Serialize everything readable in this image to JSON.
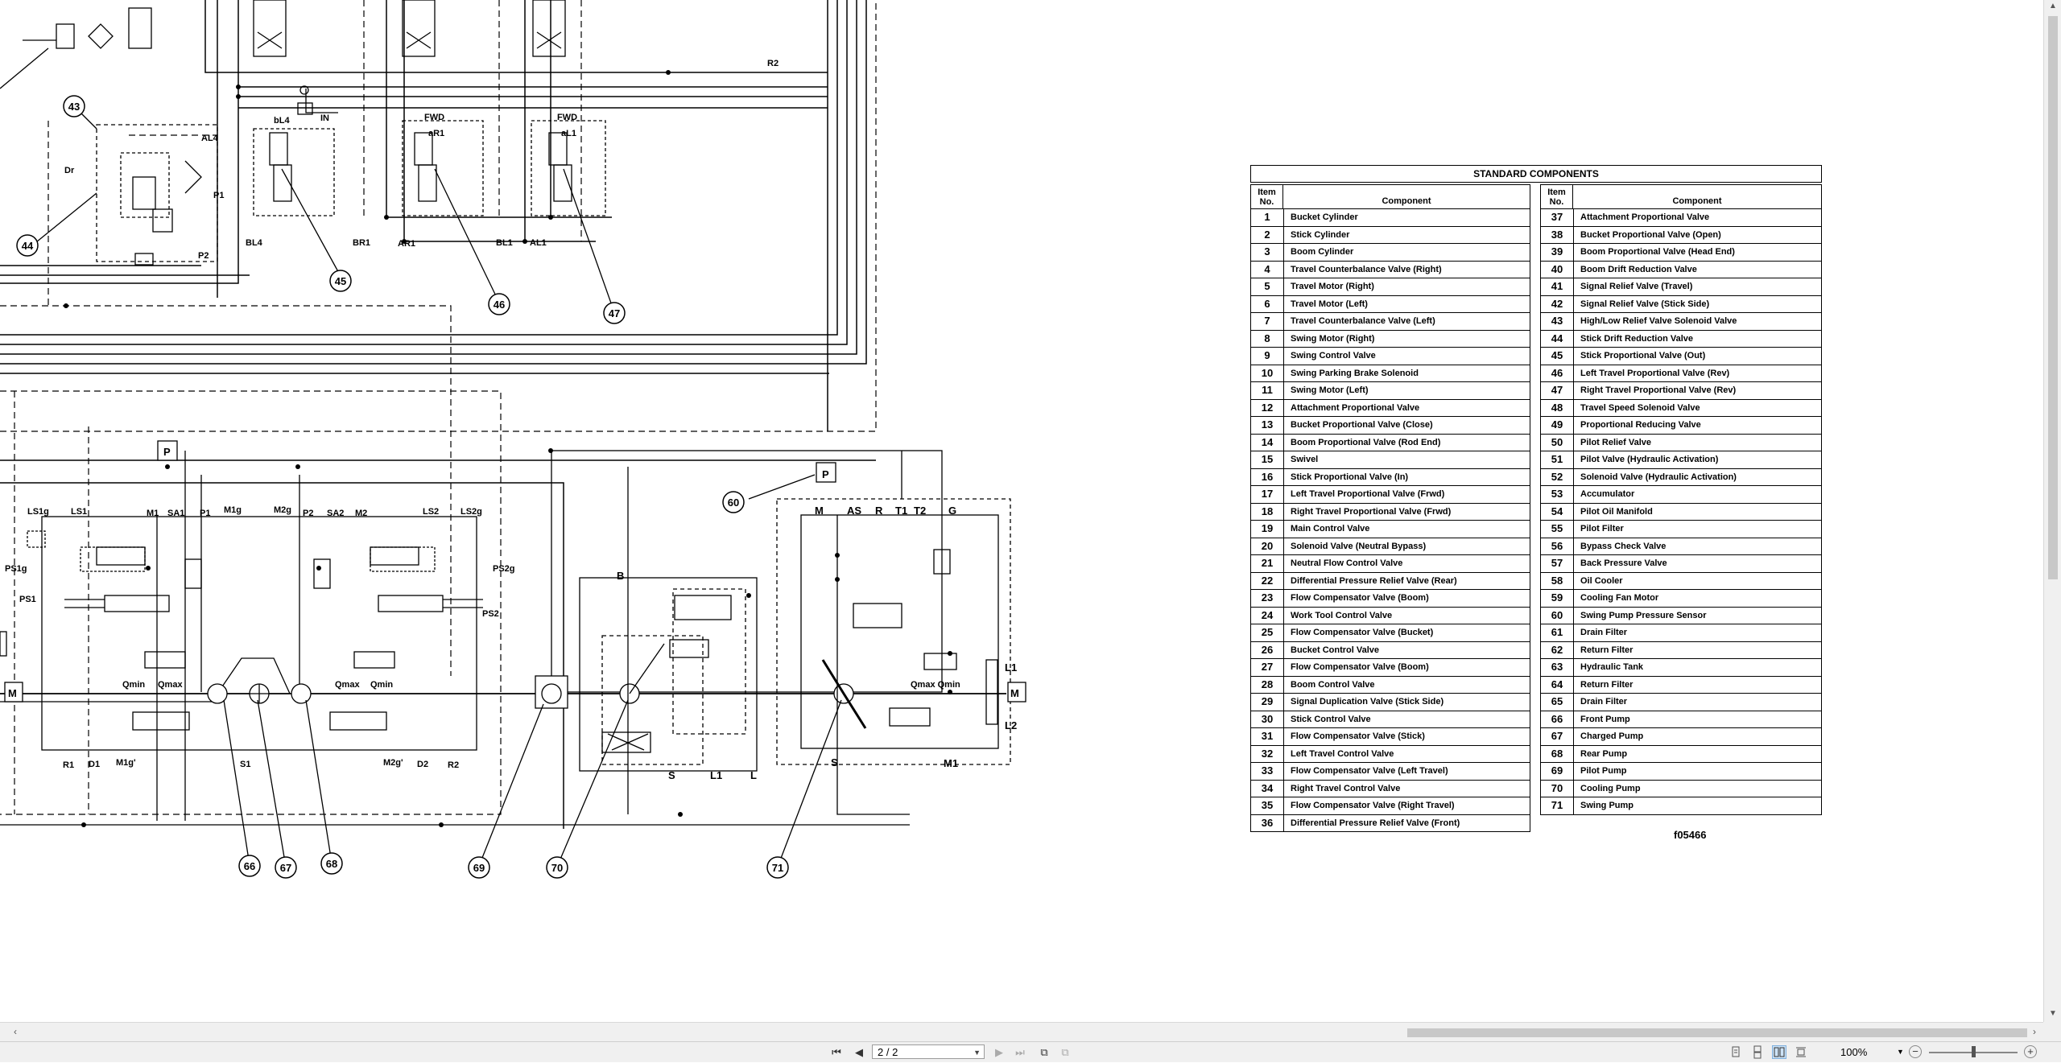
{
  "diagram": {
    "callouts": [
      "43",
      "44",
      "45",
      "46",
      "47",
      "60",
      "66",
      "67",
      "68",
      "69",
      "70",
      "71"
    ],
    "labels": {
      "AL4": "AL4",
      "Dr": "Dr",
      "P1": "P1",
      "P2": "P2",
      "bL4": "bL4",
      "IN": "IN",
      "BL4": "BL4",
      "BR1": "BR1",
      "AR1": "AR1",
      "BL1": "BL1",
      "AL1": "AL1",
      "FWD1": "FWD",
      "FWD2": "FWD",
      "aR1": "aR1",
      "aL1": "aL1",
      "R2top": "R2",
      "P_left": "P",
      "P_right": "P",
      "LS1g": "LS1g",
      "LS1": "LS1",
      "M1": "M1",
      "SA1": "SA1",
      "P1b": "P1",
      "M1g": "M1g",
      "M2g": "M2g",
      "P2b": "P2",
      "SA2": "SA2",
      "M2": "M2",
      "LS2": "LS2",
      "LS2g": "LS2g",
      "PS1g": "PS1g",
      "PS1": "PS1",
      "PS2g": "PS2g",
      "PS2": "PS2",
      "QminL": "Qmin",
      "QmaxL": "Qmax",
      "QmaxR": "Qmax",
      "QminR": "Qmin",
      "R1": "R1",
      "D1": "D1",
      "M1gp": "M1g'",
      "S1": "S1",
      "M2gp": "M2g'",
      "D2": "D2",
      "R2": "R2",
      "B": "B",
      "S": "S",
      "L1": "L1",
      "L": "L",
      "M": "M",
      "AS": "AS",
      "R": "R",
      "T1": "T1",
      "T2": "T2",
      "G": "G",
      "QmaxQmin": "Qmax Qmin",
      "L1r": "L1",
      "L2": "L2",
      "S2": "S",
      "M1r": "M1",
      "Mmotor": "M"
    }
  },
  "table": {
    "title": "STANDARD COMPONENTS",
    "col_item": "Item No.",
    "col_component": "Component",
    "left": [
      {
        "no": "1",
        "name": "Bucket Cylinder"
      },
      {
        "no": "2",
        "name": "Stick Cylinder"
      },
      {
        "no": "3",
        "name": "Boom Cylinder"
      },
      {
        "no": "4",
        "name": "Travel Counterbalance Valve (Right)"
      },
      {
        "no": "5",
        "name": "Travel Motor (Right)"
      },
      {
        "no": "6",
        "name": "Travel Motor (Left)"
      },
      {
        "no": "7",
        "name": "Travel Counterbalance Valve (Left)"
      },
      {
        "no": "8",
        "name": "Swing Motor (Right)"
      },
      {
        "no": "9",
        "name": "Swing Control Valve"
      },
      {
        "no": "10",
        "name": "Swing Parking Brake Solenoid"
      },
      {
        "no": "11",
        "name": "Swing Motor (Left)"
      },
      {
        "no": "12",
        "name": "Attachment Proportional Valve"
      },
      {
        "no": "13",
        "name": "Bucket Proportional Valve (Close)"
      },
      {
        "no": "14",
        "name": "Boom Proportional Valve (Rod End)"
      },
      {
        "no": "15",
        "name": "Swivel"
      },
      {
        "no": "16",
        "name": "Stick Proportional Valve (In)"
      },
      {
        "no": "17",
        "name": "Left Travel Proportional Valve (Frwd)"
      },
      {
        "no": "18",
        "name": "Right Travel Proportional Valve (Frwd)"
      },
      {
        "no": "19",
        "name": "Main Control Valve"
      },
      {
        "no": "20",
        "name": "Solenoid Valve (Neutral Bypass)"
      },
      {
        "no": "21",
        "name": "Neutral Flow Control Valve"
      },
      {
        "no": "22",
        "name": "Differential Pressure Relief Valve (Rear)"
      },
      {
        "no": "23",
        "name": "Flow Compensator Valve (Boom)"
      },
      {
        "no": "24",
        "name": "Work Tool Control Valve"
      },
      {
        "no": "25",
        "name": "Flow Compensator Valve (Bucket)"
      },
      {
        "no": "26",
        "name": "Bucket Control Valve"
      },
      {
        "no": "27",
        "name": "Flow Compensator Valve (Boom)"
      },
      {
        "no": "28",
        "name": "Boom Control Valve"
      },
      {
        "no": "29",
        "name": "Signal Duplication Valve (Stick Side)"
      },
      {
        "no": "30",
        "name": "Stick Control Valve"
      },
      {
        "no": "31",
        "name": "Flow Compensator Valve (Stick)"
      },
      {
        "no": "32",
        "name": "Left Travel Control Valve"
      },
      {
        "no": "33",
        "name": "Flow Compensator Valve (Left Travel)"
      },
      {
        "no": "34",
        "name": "Right Travel Control Valve"
      },
      {
        "no": "35",
        "name": "Flow Compensator Valve (Right Travel)"
      },
      {
        "no": "36",
        "name": "Differential Pressure Relief Valve (Front)"
      }
    ],
    "right": [
      {
        "no": "37",
        "name": "Attachment Proportional Valve"
      },
      {
        "no": "38",
        "name": "Bucket Proportional Valve (Open)"
      },
      {
        "no": "39",
        "name": "Boom Proportional Valve (Head End)"
      },
      {
        "no": "40",
        "name": "Boom Drift Reduction Valve"
      },
      {
        "no": "41",
        "name": "Signal Relief Valve (Travel)"
      },
      {
        "no": "42",
        "name": "Signal Relief Valve (Stick Side)"
      },
      {
        "no": "43",
        "name": "High/Low Relief Valve Solenoid Valve"
      },
      {
        "no": "44",
        "name": "Stick Drift Reduction Valve"
      },
      {
        "no": "45",
        "name": "Stick Proportional Valve (Out)"
      },
      {
        "no": "46",
        "name": "Left Travel Proportional Valve (Rev)"
      },
      {
        "no": "47",
        "name": "Right Travel Proportional Valve (Rev)"
      },
      {
        "no": "48",
        "name": "Travel Speed Solenoid Valve"
      },
      {
        "no": "49",
        "name": "Proportional Reducing Valve"
      },
      {
        "no": "50",
        "name": "Pilot Relief Valve"
      },
      {
        "no": "51",
        "name": "Pilot Valve (Hydraulic Activation)"
      },
      {
        "no": "52",
        "name": "Solenoid Valve (Hydraulic Activation)"
      },
      {
        "no": "53",
        "name": "Accumulator"
      },
      {
        "no": "54",
        "name": "Pilot Oil Manifold"
      },
      {
        "no": "55",
        "name": "Pilot Filter"
      },
      {
        "no": "56",
        "name": " Bypass Check Valve"
      },
      {
        "no": "57",
        "name": "Back Pressure Valve"
      },
      {
        "no": "58",
        "name": "Oil Cooler"
      },
      {
        "no": "59",
        "name": "Cooling Fan Motor"
      },
      {
        "no": "60",
        "name": "Swing Pump Pressure Sensor"
      },
      {
        "no": "61",
        "name": "Drain Filter"
      },
      {
        "no": "62",
        "name": "Return Filter"
      },
      {
        "no": "63",
        "name": "Hydraulic Tank"
      },
      {
        "no": "64",
        "name": "Return Filter"
      },
      {
        "no": "65",
        "name": "Drain Filter"
      },
      {
        "no": "66",
        "name": "Front Pump"
      },
      {
        "no": "67",
        "name": "Charged Pump"
      },
      {
        "no": "68",
        "name": "Rear Pump"
      },
      {
        "no": "69",
        "name": "Pilot Pump"
      },
      {
        "no": "70",
        "name": "Cooling Pump"
      },
      {
        "no": "71",
        "name": "Swing Pump"
      }
    ]
  },
  "drawing_number": "f05466",
  "statusbar": {
    "page_value": "2 / 2",
    "zoom_label": "100%"
  }
}
